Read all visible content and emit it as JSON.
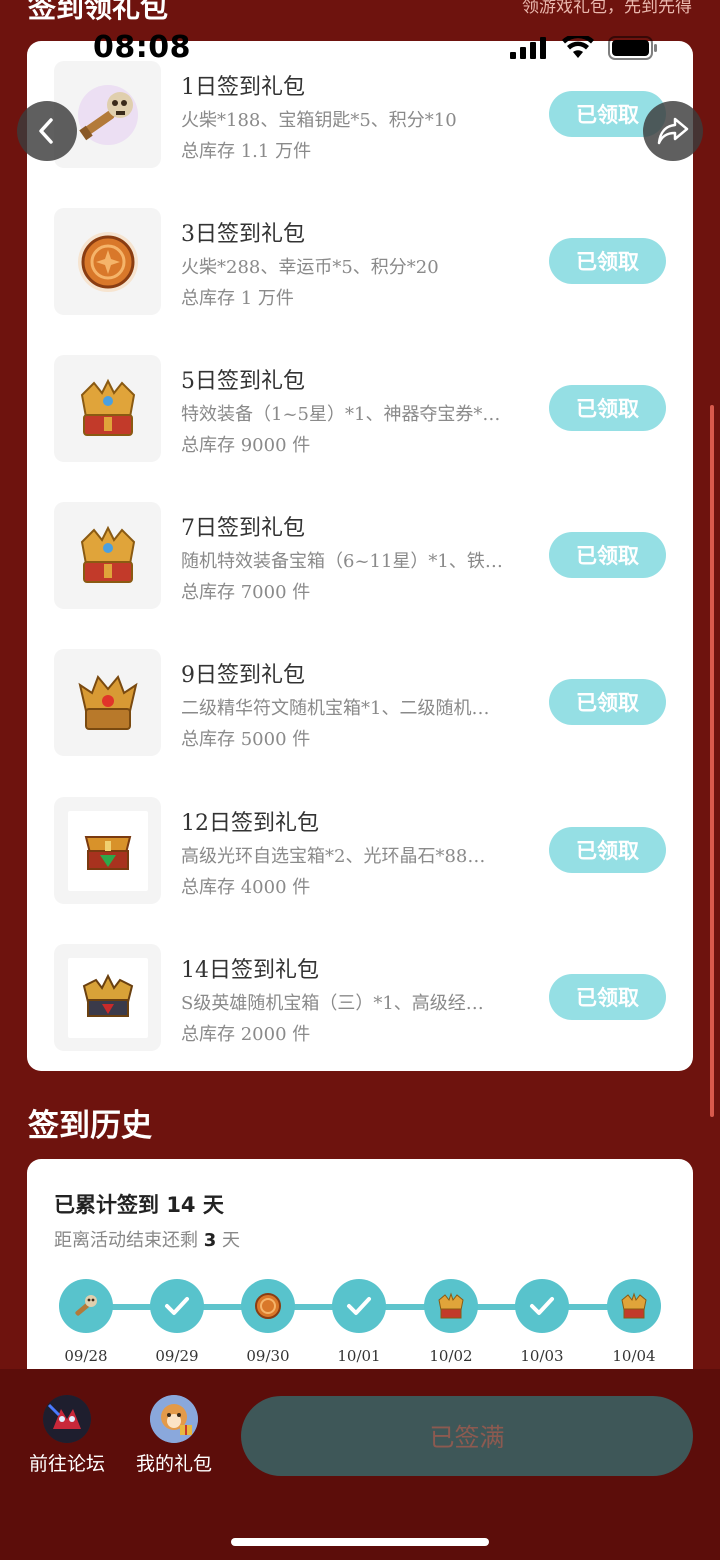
{
  "header": {
    "title": "签到领礼包",
    "subtitle": "领游戏礼包，先到先得"
  },
  "status_bar": {
    "time": "08:08"
  },
  "gifts": [
    {
      "title": "1日签到礼包",
      "desc": "火柴*188、宝箱钥匙*5、积分*10",
      "stock": "总库存 1.1 万件",
      "button": "已领取",
      "icon": "skull-key-icon"
    },
    {
      "title": "3日签到礼包",
      "desc": "火柴*288、幸运币*5、积分*20",
      "stock": "总库存 1 万件",
      "button": "已领取",
      "icon": "lucky-coin-icon"
    },
    {
      "title": "5日签到礼包",
      "desc": "特效装备（1~5星）*1、神器夺宝券*…",
      "stock": "总库存 9000 件",
      "button": "已领取",
      "icon": "gold-chest-icon"
    },
    {
      "title": "7日签到礼包",
      "desc": "随机特效装备宝箱（6~11星）*1、铁…",
      "stock": "总库存 7000 件",
      "button": "已领取",
      "icon": "gold-chest-icon"
    },
    {
      "title": "9日签到礼包",
      "desc": "二级精华符文随机宝箱*1、二级随机…",
      "stock": "总库存 5000 件",
      "button": "已领取",
      "icon": "spiked-chest-icon"
    },
    {
      "title": "12日签到礼包",
      "desc": "高级光环自选宝箱*2、光环晶石*88…",
      "stock": "总库存 4000 件",
      "button": "已领取",
      "icon": "halo-chest-icon"
    },
    {
      "title": "14日签到礼包",
      "desc": "S级英雄随机宝箱（三）*1、高级经…",
      "stock": "总库存 2000 件",
      "button": "已领取",
      "icon": "hero-chest-icon"
    }
  ],
  "history": {
    "title": "签到历史",
    "summary_prefix": "已累计签到 ",
    "summary_count": "14",
    "summary_suffix": " 天",
    "remain_prefix": "距离活动结束还剩 ",
    "remain_count": "3",
    "remain_suffix": " 天",
    "days": [
      {
        "date": "09/28",
        "icon": "skull-key-icon"
      },
      {
        "date": "09/29",
        "icon": "check-icon"
      },
      {
        "date": "09/30",
        "icon": "lucky-coin-icon"
      },
      {
        "date": "10/01",
        "icon": "check-icon"
      },
      {
        "date": "10/02",
        "icon": "gold-chest-icon"
      },
      {
        "date": "10/03",
        "icon": "check-icon"
      },
      {
        "date": "10/04",
        "icon": "gold-chest-icon"
      }
    ]
  },
  "bottom": {
    "forum_label": "前往论坛",
    "gifts_label": "我的礼包",
    "main_button": "已签满"
  },
  "colors": {
    "background": "#6e130e",
    "claimed_button": "#95dfe4",
    "track": "#58c3cc",
    "full_button": "#3e5758"
  }
}
